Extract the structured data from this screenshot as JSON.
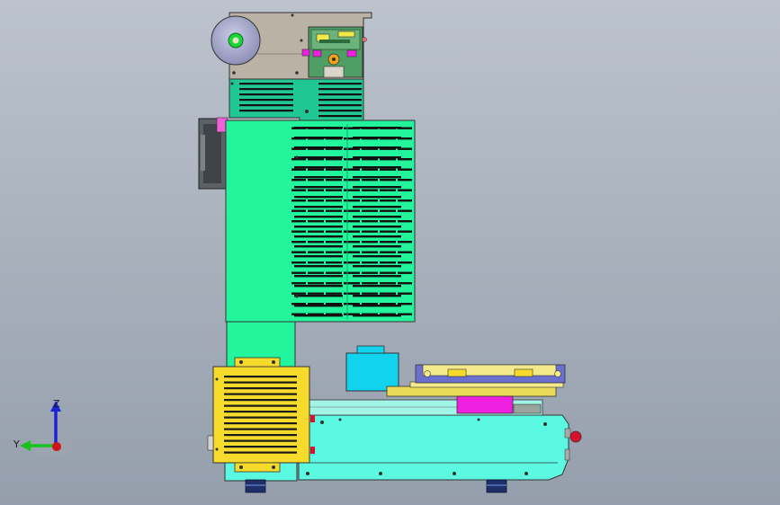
{
  "viewport": {
    "background_top": "#bcc3cd",
    "background_bottom": "#949dab"
  },
  "colors": {
    "cover_green": "#22f59b",
    "base_cyan": "#5bf8e2",
    "teal_upper": "#20c793",
    "grille_yellow": "#f7db2c",
    "rail_yellow": "#f4e98b",
    "magenta_block": "#f020e0",
    "cyan_motor": "#12d3ed",
    "blue_fixture": "#6a6fd0",
    "red_button": "#d8102b",
    "gray_housing": "#b9b2a5",
    "navy_feet": "#1e2f6a"
  },
  "triad": {
    "z_label": "Z",
    "y_label": "Y",
    "z_color": "#1a24d6",
    "y_color": "#17c21c",
    "x_color": "#d11414"
  }
}
